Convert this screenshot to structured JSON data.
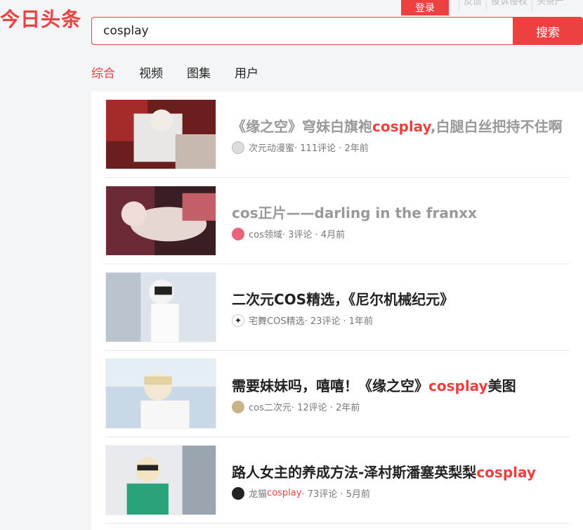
{
  "header": {
    "logo": "今日头条",
    "login": "登录",
    "links": [
      "反馈",
      "投诉侵权",
      "头条产"
    ]
  },
  "search": {
    "value": "cosplay",
    "button": "搜索"
  },
  "tabs": [
    {
      "label": "综合",
      "active": true
    },
    {
      "label": "视频"
    },
    {
      "label": "图集"
    },
    {
      "label": "用户"
    }
  ],
  "results": [
    {
      "title_pre": "《缘之空》穹妹白旗袍",
      "title_hl": "cosplay",
      "title_post": ",白腿白丝把持不住啊",
      "read": true,
      "source_pre": "次元动漫蜜",
      "source_hl": "",
      "stats": " · 111评论 · 2年前",
      "avatar_color": "#dcdcdc"
    },
    {
      "title_pre": "cos正片——darling in the franxx",
      "title_hl": "",
      "title_post": "",
      "read": true,
      "source_pre": "cos领域",
      "source_hl": "",
      "stats": " · 3评论 · 4月前",
      "avatar_color": "#e8637a"
    },
    {
      "title_pre": "二次元COS精选，《尼尔机械纪元》",
      "title_hl": "",
      "title_post": "",
      "read": false,
      "source_pre": "宅舞COS精选",
      "source_hl": "",
      "stats": " · 23评论 · 1年前",
      "avatar_color": "#444444"
    },
    {
      "title_pre": "需要妹妹吗，嘻嘻！《缘之空》",
      "title_hl": "cosplay",
      "title_post": "美图",
      "read": false,
      "source_pre": "cos二次元",
      "source_hl": "",
      "stats": " · 12评论 · 2年前",
      "avatar_color": "#c9b48a"
    },
    {
      "title_pre": "路人女主的养成方法-泽村斯潘塞英梨梨",
      "title_hl": "cosplay",
      "title_post": "",
      "read": false,
      "source_pre": "龙猫",
      "source_hl": "cosplay",
      "stats": " · 73评论 · 5月前",
      "avatar_color": "#222222"
    }
  ]
}
